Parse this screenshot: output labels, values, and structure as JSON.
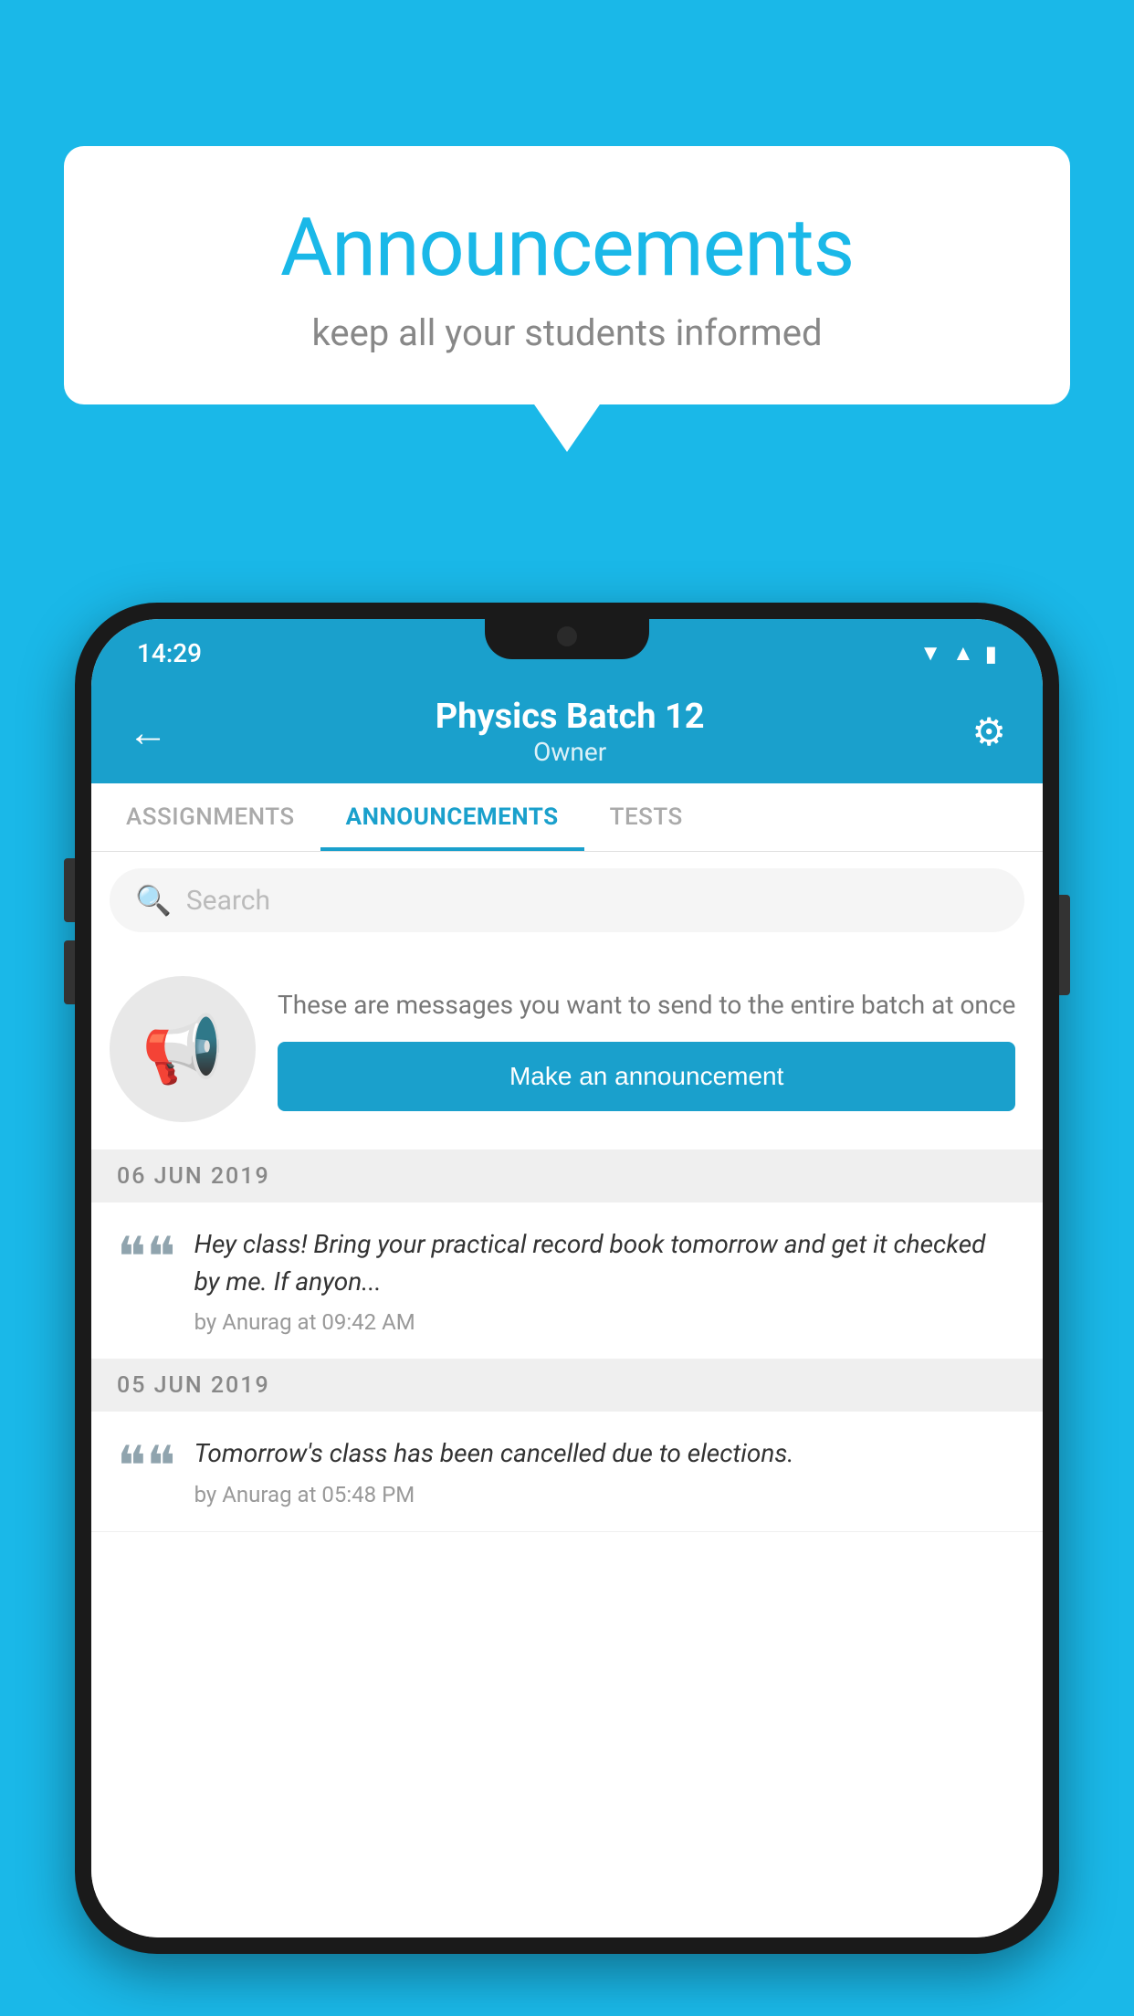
{
  "bubble": {
    "title": "Announcements",
    "subtitle": "keep all your students informed"
  },
  "phone": {
    "status_bar": {
      "time": "14:29"
    },
    "header": {
      "title": "Physics Batch 12",
      "subtitle": "Owner",
      "back_label": "←",
      "gear_label": "⚙"
    },
    "tabs": [
      {
        "label": "ASSIGNMENTS",
        "active": false
      },
      {
        "label": "ANNOUNCEMENTS",
        "active": true
      },
      {
        "label": "TESTS",
        "active": false
      }
    ],
    "search": {
      "placeholder": "Search"
    },
    "cta": {
      "description": "These are messages you want to send to the entire batch at once",
      "button_label": "Make an announcement"
    },
    "dates": [
      {
        "label": "06  JUN  2019",
        "announcements": [
          {
            "text": "Hey class! Bring your practical record book tomorrow and get it checked by me. If anyon...",
            "meta": "by Anurag at 09:42 AM"
          }
        ]
      },
      {
        "label": "05  JUN  2019",
        "announcements": [
          {
            "text": "Tomorrow's class has been cancelled due to elections.",
            "meta": "by Anurag at 05:48 PM"
          }
        ]
      }
    ]
  }
}
